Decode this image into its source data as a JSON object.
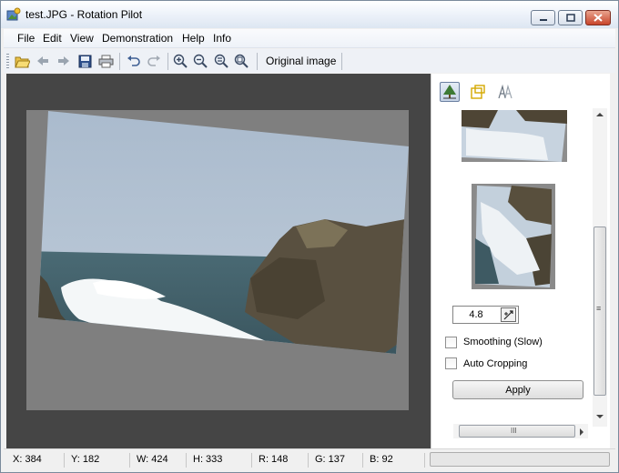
{
  "window": {
    "title": "test.JPG - Rotation Pilot",
    "app_icon": "rotation-pilot-app-icon",
    "controls": [
      "minimize",
      "maximize",
      "close"
    ]
  },
  "menu": {
    "items": [
      "File",
      "Edit",
      "View",
      "Demonstration",
      "Help",
      "Info"
    ]
  },
  "toolbar": {
    "buttons": [
      "open-folder",
      "back",
      "forward",
      "save",
      "print",
      "undo",
      "redo",
      "zoom-in",
      "zoom-out",
      "zoom-fit",
      "zoom-actual"
    ],
    "original_image_label": "Original image"
  },
  "panel": {
    "mode_icons": [
      "rotate-mode",
      "crop-mode",
      "mirror-mode"
    ],
    "angle_value": "4.8",
    "smoothing_label": "Smoothing (Slow)",
    "smoothing_checked": false,
    "auto_crop_label": "Auto Cropping",
    "auto_crop_checked": false,
    "apply_label": "Apply",
    "scroll_grip": "≡",
    "hscroll_grip": "III"
  },
  "status": {
    "x": "X: 384",
    "y": "Y: 182",
    "w": "W: 424",
    "h": "H: 333",
    "r": "R: 148",
    "g": "G: 137",
    "b": "B: 92",
    "progress": 0
  },
  "colors": {
    "canvas_bg": "#454545",
    "sky": "#b7c6d6",
    "sea": "#3d5a63",
    "rock": "#5b5440",
    "foam": "#ffffff"
  }
}
